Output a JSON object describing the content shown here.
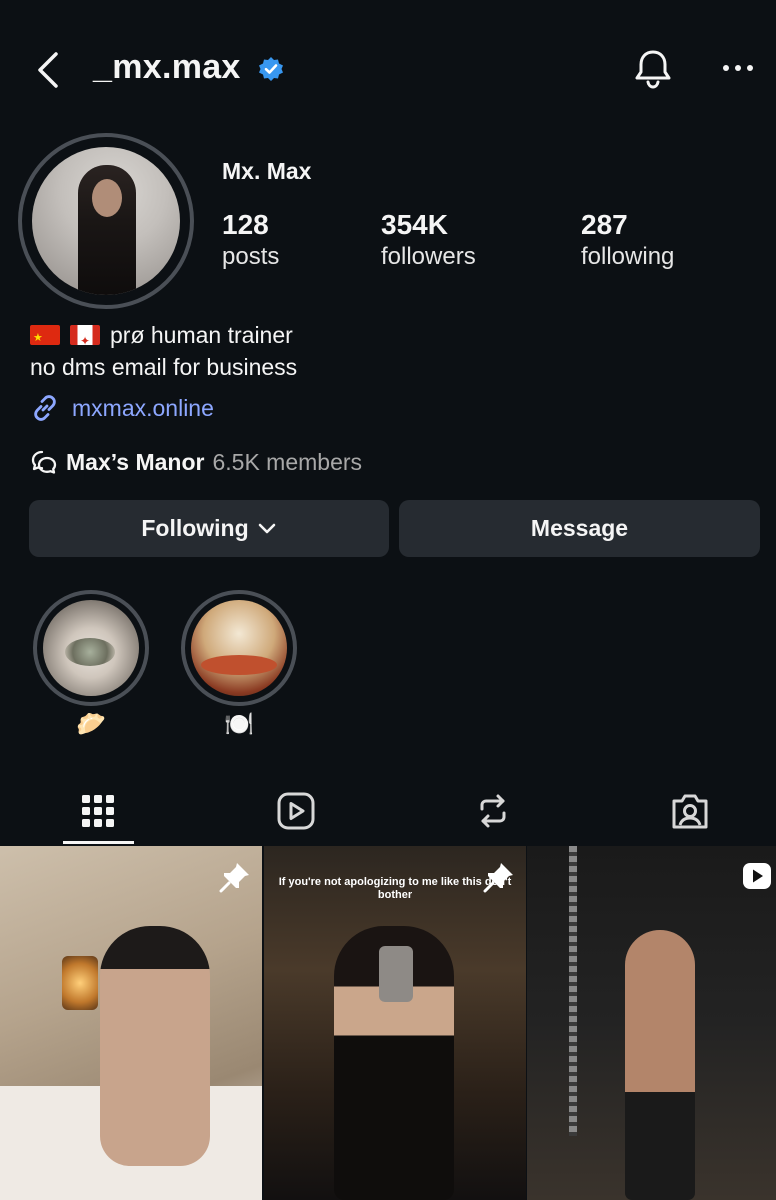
{
  "header": {
    "username": "_mx.max",
    "verified": true,
    "icons": [
      "back-chevron-icon",
      "verified-badge-icon",
      "bell-icon",
      "more-dots-icon"
    ]
  },
  "profile": {
    "display_name": "Mx. Max",
    "stats": [
      {
        "value": "128",
        "label": "posts"
      },
      {
        "value": "354K",
        "label": "followers"
      },
      {
        "value": "287",
        "label": "following"
      }
    ],
    "bio_line1": "prø human trainer",
    "bio_flags": [
      "china-flag",
      "canada-flag"
    ],
    "bio_line2": "no dms email for business",
    "link": "mxmax.online",
    "community_name": "Max’s Manor",
    "community_members": "6.5K members"
  },
  "actions": {
    "following_label": "Following",
    "message_label": "Message"
  },
  "highlights": [
    {
      "emoji": "🥟"
    },
    {
      "emoji": "🍽️"
    }
  ],
  "tabs": [
    "grid-icon",
    "reels-icon",
    "reposts-icon",
    "tagged-icon"
  ],
  "posts": [
    {
      "pinned": true
    },
    {
      "pinned": true,
      "caption": "If you're not apologizing to me like this don't bother"
    },
    {
      "reel": true
    }
  ],
  "colors": {
    "background": "#0c1014",
    "button": "#262b31",
    "link": "#8da7ff",
    "verified": "#3897f0",
    "muted": "#a8a8a8"
  }
}
